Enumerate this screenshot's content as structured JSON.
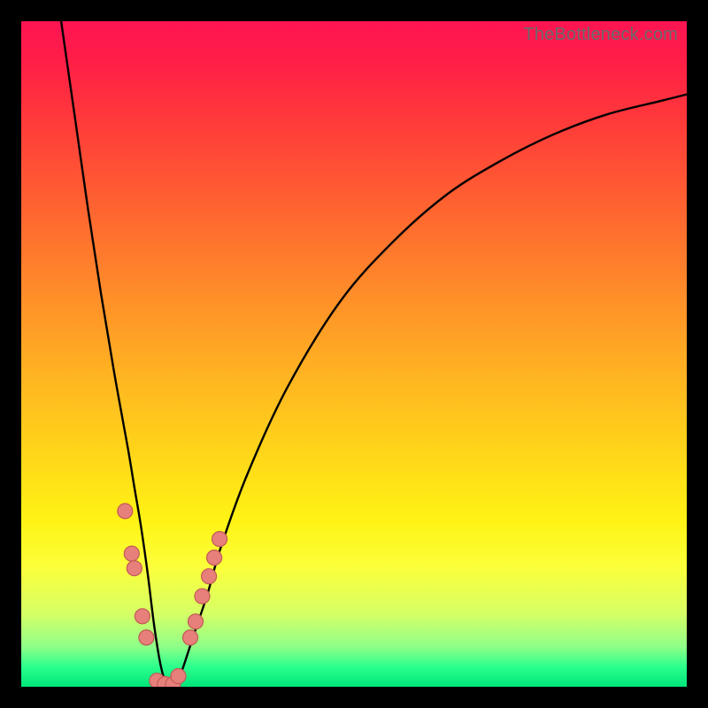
{
  "watermark": "TheBottleneck.com",
  "colors": {
    "gradient_top": "#ff1452",
    "gradient_bottom": "#00e57a",
    "curve": "#000000",
    "dot_fill": "#e77f7a",
    "dot_stroke": "#c25a55",
    "frame": "#000000"
  },
  "chart_data": {
    "type": "line",
    "title": "",
    "xlabel": "",
    "ylabel": "",
    "xlim": [
      0,
      100
    ],
    "ylim": [
      0,
      100
    ],
    "grid": false,
    "legend": null,
    "series": [
      {
        "name": "bottleneck-curve",
        "x": [
          6,
          8,
          10,
          12,
          14,
          16,
          17,
          18,
          19,
          20,
          21,
          22,
          23,
          24,
          26,
          28,
          30,
          34,
          40,
          48,
          56,
          64,
          72,
          80,
          88,
          96,
          100
        ],
        "y": [
          100,
          86,
          72,
          59,
          47,
          36,
          30,
          24,
          17,
          9,
          3,
          0,
          0,
          2,
          8,
          14,
          21,
          32,
          45,
          58,
          67,
          74,
          79,
          83,
          86,
          88,
          89
        ]
      }
    ],
    "markers": [
      {
        "name": "dot",
        "x": 15.6,
        "y": 26.4
      },
      {
        "name": "dot",
        "x": 16.6,
        "y": 20.0
      },
      {
        "name": "dot",
        "x": 17.0,
        "y": 17.8
      },
      {
        "name": "dot",
        "x": 18.2,
        "y": 10.6
      },
      {
        "name": "dot",
        "x": 18.8,
        "y": 7.4
      },
      {
        "name": "dot",
        "x": 20.4,
        "y": 0.9
      },
      {
        "name": "dot",
        "x": 21.6,
        "y": 0.4
      },
      {
        "name": "dot",
        "x": 22.8,
        "y": 0.4
      },
      {
        "name": "dot",
        "x": 23.6,
        "y": 1.6
      },
      {
        "name": "dot",
        "x": 25.4,
        "y": 7.4
      },
      {
        "name": "dot",
        "x": 26.2,
        "y": 9.8
      },
      {
        "name": "dot",
        "x": 27.2,
        "y": 13.6
      },
      {
        "name": "dot",
        "x": 28.2,
        "y": 16.6
      },
      {
        "name": "dot",
        "x": 29.0,
        "y": 19.4
      },
      {
        "name": "dot",
        "x": 29.8,
        "y": 22.2
      }
    ],
    "note": "x is horizontal position in % of plot width; y is vertical height in % of plot height measured from the bottom (0 = floor, 100 = top). Curve minimum ≈ x 21–23."
  }
}
